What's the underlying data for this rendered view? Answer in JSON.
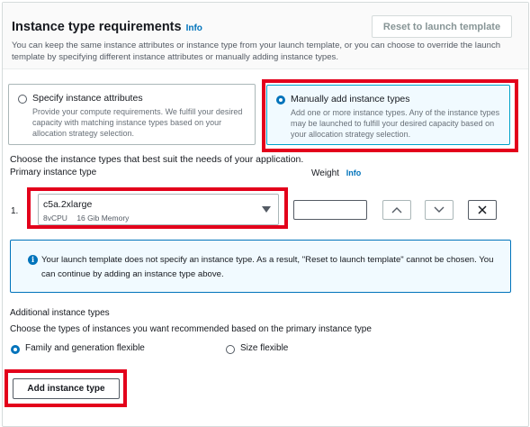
{
  "header": {
    "title": "Instance type requirements",
    "info": "Info",
    "reset_button": "Reset to launch template",
    "description": "You can keep the same instance attributes or instance type from your launch template, or you can choose to override the launch template by specifying different instance attributes or manually adding instance types."
  },
  "options": [
    {
      "title": "Specify instance attributes",
      "description": "Provide your compute requirements. We fulfill your desired capacity with matching instance types based on your allocation strategy selection.",
      "selected": false
    },
    {
      "title": "Manually add instance types",
      "description": "Add one or more instance types. Any of the instance types may be launched to fulfill your desired capacity based on your allocation strategy selection.",
      "selected": true
    }
  ],
  "instance_list": {
    "intro": "Choose the instance types that best suit the needs of your application.",
    "primary_label": "Primary instance type",
    "weight_label": "Weight",
    "weight_info": "Info",
    "rows": [
      {
        "index": "1.",
        "instance_type": "c5a.2xlarge",
        "vcpu": "8vCPU",
        "memory": "16 Gib Memory",
        "weight": ""
      }
    ]
  },
  "alert": {
    "icon": "info-icon",
    "text": "Your launch template does not specify an instance type. As a result, \"Reset to launch template\" cannot be chosen. You can continue by adding an instance type above."
  },
  "additional": {
    "title": "Additional instance types",
    "description": "Choose the types of instances you want recommended based on the primary instance type",
    "choices": [
      {
        "label": "Family and generation flexible",
        "selected": true
      },
      {
        "label": "Size flexible",
        "selected": false
      }
    ]
  },
  "add_button": "Add instance type",
  "colors": {
    "accent": "#0073bb",
    "highlight": "#e3001b",
    "selected_bg": "#f1faff"
  }
}
